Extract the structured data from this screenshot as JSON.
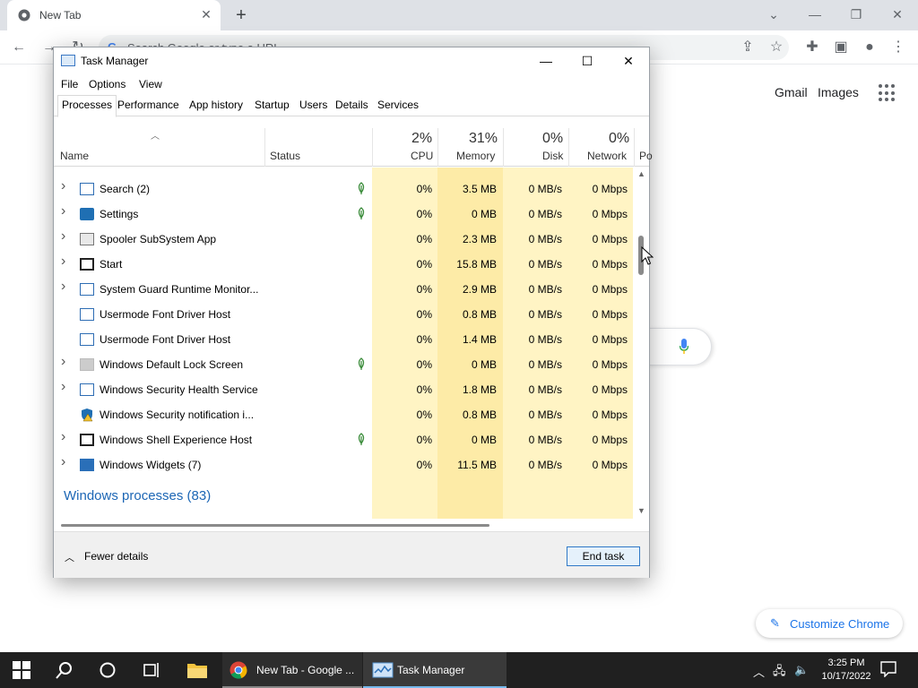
{
  "chrome": {
    "tab_title": "New Tab",
    "omnibox_placeholder": "Search Google or type a URL",
    "ntp_links": [
      "Gmail",
      "Images"
    ],
    "customize_label": "Customize Chrome"
  },
  "task_manager": {
    "title": "Task Manager",
    "menus": [
      "File",
      "Options",
      "View"
    ],
    "tabs": [
      "Processes",
      "Performance",
      "App history",
      "Startup",
      "Users",
      "Details",
      "Services"
    ],
    "active_tab": "Processes",
    "columns": {
      "name": "Name",
      "status": "Status",
      "cpu": {
        "pct": "2%",
        "label": "CPU"
      },
      "memory": {
        "pct": "31%",
        "label": "Memory"
      },
      "disk": {
        "pct": "0%",
        "label": "Disk"
      },
      "network": {
        "pct": "0%",
        "label": "Network"
      },
      "power": "Po"
    },
    "processes": [
      {
        "name": "Search (2)",
        "expandable": true,
        "icon": "search-app-icon",
        "suspended": true,
        "cpu": "0%",
        "memory": "3.5 MB",
        "disk": "0 MB/s",
        "network": "0 Mbps"
      },
      {
        "name": "Settings",
        "expandable": true,
        "icon": "settings-gear-icon",
        "suspended": true,
        "cpu": "0%",
        "memory": "0 MB",
        "disk": "0 MB/s",
        "network": "0 Mbps"
      },
      {
        "name": "Spooler SubSystem App",
        "expandable": true,
        "icon": "printer-icon",
        "suspended": false,
        "cpu": "0%",
        "memory": "2.3 MB",
        "disk": "0 MB/s",
        "network": "0 Mbps"
      },
      {
        "name": "Start",
        "expandable": true,
        "icon": "start-app-icon",
        "suspended": false,
        "cpu": "0%",
        "memory": "15.8 MB",
        "disk": "0 MB/s",
        "network": "0 Mbps"
      },
      {
        "name": "System Guard Runtime Monitor...",
        "expandable": true,
        "icon": "app-window-icon",
        "suspended": false,
        "cpu": "0%",
        "memory": "2.9 MB",
        "disk": "0 MB/s",
        "network": "0 Mbps"
      },
      {
        "name": "Usermode Font Driver Host",
        "expandable": false,
        "icon": "app-window-icon",
        "suspended": false,
        "cpu": "0%",
        "memory": "0.8 MB",
        "disk": "0 MB/s",
        "network": "0 Mbps"
      },
      {
        "name": "Usermode Font Driver Host",
        "expandable": false,
        "icon": "app-window-icon",
        "suspended": false,
        "cpu": "0%",
        "memory": "1.4 MB",
        "disk": "0 MB/s",
        "network": "0 Mbps"
      },
      {
        "name": "Windows Default Lock Screen",
        "expandable": true,
        "icon": "lock-screen-icon",
        "suspended": true,
        "cpu": "0%",
        "memory": "0 MB",
        "disk": "0 MB/s",
        "network": "0 Mbps"
      },
      {
        "name": "Windows Security Health Service",
        "expandable": true,
        "icon": "app-window-icon",
        "suspended": false,
        "cpu": "0%",
        "memory": "1.8 MB",
        "disk": "0 MB/s",
        "network": "0 Mbps"
      },
      {
        "name": "Windows Security notification i...",
        "expandable": false,
        "icon": "security-shield-icon",
        "suspended": false,
        "cpu": "0%",
        "memory": "0.8 MB",
        "disk": "0 MB/s",
        "network": "0 Mbps"
      },
      {
        "name": "Windows Shell Experience Host",
        "expandable": true,
        "icon": "start-app-icon",
        "suspended": true,
        "cpu": "0%",
        "memory": "0 MB",
        "disk": "0 MB/s",
        "network": "0 Mbps"
      },
      {
        "name": "Windows Widgets (7)",
        "expandable": true,
        "icon": "widgets-icon",
        "suspended": false,
        "cpu": "0%",
        "memory": "11.5 MB",
        "disk": "0 MB/s",
        "network": "0 Mbps"
      }
    ],
    "group_header": "Windows processes (83)",
    "fewer_details": "Fewer details",
    "end_task": "End task"
  },
  "taskbar": {
    "apps": [
      {
        "label": "New Tab - Google ...",
        "icon": "chrome-icon"
      },
      {
        "label": "Task Manager",
        "icon": "task-manager-icon"
      }
    ],
    "time": "3:25 PM",
    "date": "10/17/2022"
  },
  "colors": {
    "heat_light": "#fff4c4",
    "heat_medium": "#fdeba7",
    "accent_blue": "#1c66b5",
    "taskbar": "#202020"
  }
}
